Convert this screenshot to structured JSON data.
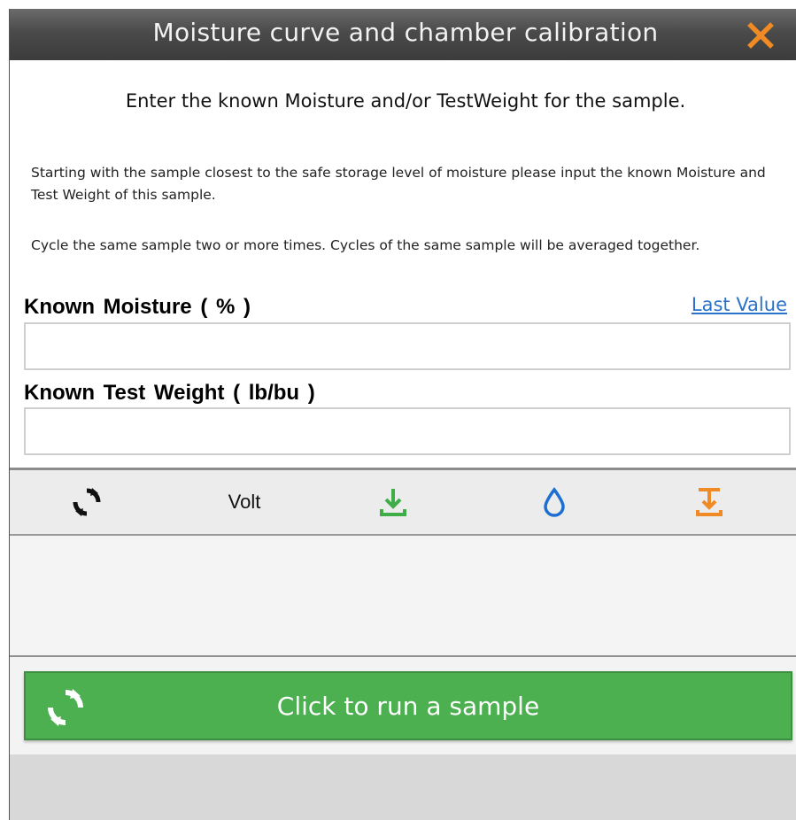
{
  "window": {
    "title": "Moisture curve and chamber calibration"
  },
  "instructions": {
    "prompt": "Enter the known Moisture and/or TestWeight for the sample.",
    "paragraph1": "Starting with the sample closest to the safe storage level of moisture please input the known Moisture and Test Weight of this sample.",
    "paragraph2": "Cycle the same sample two or more times. Cycles of the same sample will be averaged together."
  },
  "fields": {
    "moisture_label": "Known  Moisture  ( % )",
    "moisture_value": "",
    "last_value_link": "Last Value",
    "test_weight_label": "Known  Test Weight  ( lb/bu )",
    "test_weight_value": ""
  },
  "results_header": {
    "cycle_icon": "cycle-icon",
    "volt_label": "Volt",
    "download_icon": "download-icon",
    "moisture_icon": "water-drop-icon",
    "test_weight_icon": "test-weight-icon"
  },
  "run_button": {
    "label": "Click to run a sample",
    "icon": "cycle-icon"
  },
  "colors": {
    "title_bar": "#4a4a4a",
    "close": "#f08a24",
    "link": "#2a73c9",
    "green": "#4caf50",
    "download_green": "#3fae49",
    "drop_blue": "#1c6fd1",
    "orange": "#f08a24"
  }
}
